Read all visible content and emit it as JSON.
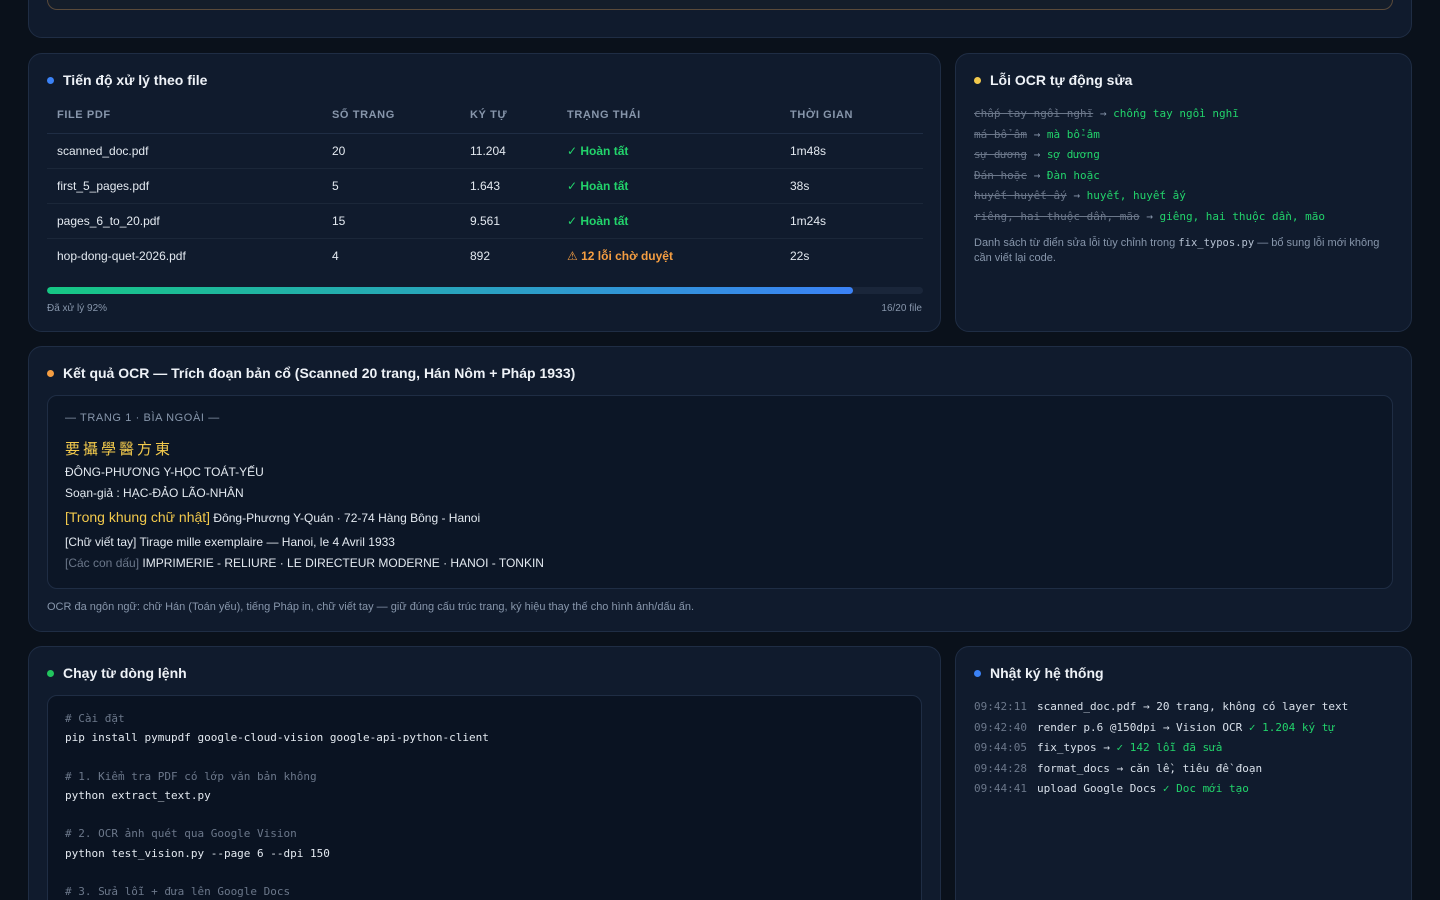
{
  "progress": {
    "title": "Tiến độ xử lý theo file",
    "headers": [
      "FILE PDF",
      "SỐ TRANG",
      "KÝ TỰ",
      "TRẠNG THÁI",
      "THỜI GIAN"
    ],
    "rows": [
      {
        "file": "scanned_doc.pdf",
        "pages": "20",
        "chars": "11.204",
        "status": "✓ Hoàn tất",
        "status_kind": "ok",
        "time": "1m48s"
      },
      {
        "file": "first_5_pages.pdf",
        "pages": "5",
        "chars": "1.643",
        "status": "✓ Hoàn tất",
        "status_kind": "ok",
        "time": "38s"
      },
      {
        "file": "pages_6_to_20.pdf",
        "pages": "15",
        "chars": "9.561",
        "status": "✓ Hoàn tất",
        "status_kind": "ok",
        "time": "1m24s"
      },
      {
        "file": "hop-dong-quet-2026.pdf",
        "pages": "4",
        "chars": "892",
        "status": "⚠ 12 lỗi chờ duyệt",
        "status_kind": "warn",
        "time": "22s"
      }
    ],
    "percent": 92,
    "done_label": "Đã xử lý 92%",
    "count_label": "16/20 file"
  },
  "fixes": {
    "title": "Lỗi OCR tự động sửa",
    "items": [
      {
        "old": "chấp tay ngồi nghĩ",
        "new": "chống tay ngồi nghĩ"
      },
      {
        "old": "má bổ âm",
        "new": "mà bổ-âm"
      },
      {
        "old": "sự dương",
        "new": "sợ dương"
      },
      {
        "old": "Đán hoặc",
        "new": "Đàn hoặc"
      },
      {
        "old": "huyết huyết ấy",
        "new": "huyết, huyết ấy"
      },
      {
        "old": "riêng, hai thuộc dần, mão",
        "new": "giêng, hai thuộc dần, mão"
      }
    ],
    "arrow": "→",
    "note_pre": "Danh sách từ điển sửa lỗi tùy chỉnh trong ",
    "note_code": "fix_typos.py",
    "note_post": " — bổ sung lỗi mới không cần viết lại code."
  },
  "result": {
    "title": "Kết quả OCR — Trích đoạn bản cổ (Scanned 20 trang, Hán Nôm + Pháp 1933)",
    "page_label": "— TRANG 1 · BÌA NGOÀI —",
    "han": "要攝學醫方東",
    "line1": "ĐÔNG-PHƯƠNG Y-HỌC TOÁT-YẾU",
    "line2": "Soạn-giả : HẠC-ĐẢO LÃO-NHÂN",
    "tag_frame": "[Trong khung chữ nhật]",
    "line3": " Đông-Phương Y-Quán · 72-74 Hàng Bông - Hanoi",
    "line4": "[Chữ viết tay] Tirage mille exemplaire — Hanoi, le 4 Avril 1933",
    "tag_stamp": "[Các con dấu]",
    "line5": " IMPRIMERIE - RELIURE · LE DIRECTEUR MODERNE · HANOI - TONKIN",
    "note": "OCR đa ngôn ngữ: chữ Hán (Toán yếu), tiếng Pháp in, chữ viết tay — giữ đúng cấu trúc trang, ký hiệu thay thế cho hình ảnh/dấu ấn."
  },
  "cli": {
    "title": "Chạy từ dòng lệnh",
    "c1": "# Cài đặt",
    "l1": "pip install pymupdf google-cloud-vision google-api-python-client",
    "c2": "# 1. Kiểm tra PDF có lớp văn bản không",
    "l2": "python extract_text.py",
    "c3": "# 2. OCR ảnh quét qua Google Vision",
    "l3": "python test_vision.py --page 6 --dpi 150",
    "c4": "# 3. Sửa lỗi + đưa lên Google Docs"
  },
  "log": {
    "title": "Nhật ký hệ thống",
    "rows": [
      {
        "time": "09:42:11",
        "msg": "scanned_doc.pdf → 20 trang, không có layer text",
        "ok": ""
      },
      {
        "time": "09:42:40",
        "msg": "render p.6 @150dpi → Vision OCR ",
        "ok": "✓ 1.204 ký tự"
      },
      {
        "time": "09:44:05",
        "msg": "fix_typos → ",
        "ok": "✓ 142 lỗi đã sửa"
      },
      {
        "time": "09:44:28",
        "msg": "format_docs → căn lề, tiêu đề đoạn",
        "ok": ""
      },
      {
        "time": "09:44:41",
        "msg": "upload Google Docs ",
        "ok": "✓ Doc mới tạo"
      }
    ]
  }
}
